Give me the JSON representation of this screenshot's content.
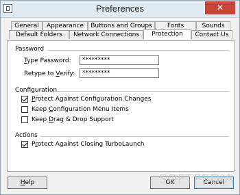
{
  "window": {
    "title": "Preferences"
  },
  "titlebar": {
    "close_glyph": "✕"
  },
  "tabs": {
    "row1": [
      "General",
      "Appearance",
      "Buttons and Groups",
      "Fonts",
      "Sounds"
    ],
    "row2": [
      "Default Folders",
      "Network Connections",
      "Protection",
      "Contact Us"
    ],
    "active": "Protection"
  },
  "password": {
    "section_title": "Password",
    "type_label_pre": "",
    "type_label_u": "T",
    "type_label_post": "ype Password:",
    "type_value": "*********",
    "verify_label_pre": "Retype to ",
    "verify_label_u": "V",
    "verify_label_post": "erify:",
    "verify_value": "*********"
  },
  "configuration": {
    "section_title": "Configuration",
    "items": [
      {
        "pre": "",
        "u": "P",
        "post": "rotect Against Configuration Changes",
        "checked": true
      },
      {
        "pre": "Keep ",
        "u": "C",
        "post": "onfiguration Menu Items",
        "checked": false
      },
      {
        "pre": "Keep ",
        "u": "D",
        "post": "rag & Drop Support",
        "checked": false
      }
    ]
  },
  "actions": {
    "section_title": "Actions",
    "items": [
      {
        "pre": "P",
        "u": "r",
        "post": "otect Against Closing TurboLaunch",
        "checked": true
      }
    ]
  },
  "buttons": {
    "help_u": "H",
    "help_rest": "elp",
    "ok": "OK",
    "cancel": "Cancel"
  },
  "watermark": "SOFTPEDIA"
}
